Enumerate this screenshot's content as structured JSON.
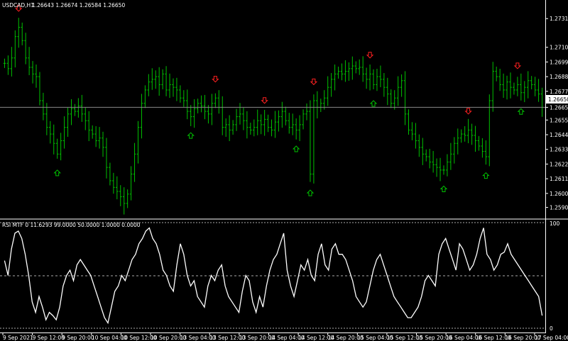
{
  "main_panel": {
    "symbol_label": "USDCAD,H1",
    "ohlc_label": "1.26643 1.26674 1.26584 1.26650",
    "current_price_label": "1.26650",
    "y_ticks": [
      "1.27315",
      "1.27100",
      "1.26990",
      "1.26880",
      "1.26770",
      "1.26650",
      "1.26555",
      "1.26445",
      "1.26335",
      "1.26225",
      "1.26115",
      "1.26005",
      "1.25900"
    ]
  },
  "rsi_panel": {
    "label": "RSI MTF 0 11.6293 99.0000 50.0000 1.0000 0.0000",
    "y_ticks": [
      "100",
      "0"
    ]
  },
  "x_ticks": [
    "9 Sep 2021",
    "9 Sep 12:00",
    "9 Sep 20:00",
    "10 Sep 04:00",
    "10 Sep 12:00",
    "10 Sep 20:00",
    "13 Sep 04:00",
    "13 Sep 12:00",
    "13 Sep 20:00",
    "14 Sep 04:00",
    "14 Sep 12:00",
    "14 Sep 20:00",
    "15 Sep 04:00",
    "15 Sep 12:00",
    "15 Sep 20:00",
    "16 Sep 04:00",
    "16 Sep 12:00",
    "16 Sep 20:00",
    "17 Sep 04:00"
  ],
  "chart_data": [
    {
      "type": "bar",
      "title": "USDCAD,H1",
      "series_style": "ohlc bars (green)",
      "ylim": [
        1.2585,
        1.2738
      ],
      "current_price": 1.2665,
      "close": [
        1.2698,
        1.2694,
        1.2702,
        1.2718,
        1.2725,
        1.2715,
        1.2702,
        1.2695,
        1.269,
        1.2688,
        1.267,
        1.266,
        1.265,
        1.2645,
        1.2638,
        1.263,
        1.264,
        1.265,
        1.266,
        1.2664,
        1.2662,
        1.2666,
        1.266,
        1.2655,
        1.2648,
        1.2645,
        1.264,
        1.2642,
        1.2635,
        1.262,
        1.261,
        1.2605,
        1.2602,
        1.2598,
        1.2593,
        1.26,
        1.2615,
        1.263,
        1.265,
        1.2668,
        1.2678,
        1.2684,
        1.2686,
        1.2688,
        1.2682,
        1.269,
        1.2678,
        1.2682,
        1.268,
        1.2678,
        1.2672,
        1.267,
        1.2662,
        1.2658,
        1.2664,
        1.2668,
        1.2666,
        1.2662,
        1.266,
        1.2668,
        1.2672,
        1.2665,
        1.265,
        1.2652,
        1.2648,
        1.2652,
        1.2658,
        1.266,
        1.2655,
        1.265,
        1.2648,
        1.265,
        1.2655,
        1.2652,
        1.2656,
        1.265,
        1.2648,
        1.2654,
        1.2658,
        1.2662,
        1.2655,
        1.265,
        1.2652,
        1.2648,
        1.2652,
        1.266,
        1.2662,
        1.2615,
        1.267,
        1.2665,
        1.2668,
        1.2672,
        1.268,
        1.2686,
        1.269,
        1.2692,
        1.269,
        1.2692,
        1.2694,
        1.2696,
        1.2694,
        1.2695,
        1.269,
        1.2686,
        1.269,
        1.2682,
        1.2688,
        1.2686,
        1.268,
        1.2675,
        1.2668,
        1.2672,
        1.268,
        1.2685,
        1.266,
        1.2648,
        1.2645,
        1.264,
        1.2635,
        1.263,
        1.2628,
        1.2624,
        1.2622,
        1.262,
        1.2618,
        1.2618,
        1.2624,
        1.263,
        1.2638,
        1.2642,
        1.2645,
        1.2644,
        1.2648,
        1.2644,
        1.264,
        1.2636,
        1.2632,
        1.2628,
        1.267,
        1.2692,
        1.2688,
        1.2682,
        1.2678,
        1.2684,
        1.268,
        1.2678,
        1.2682,
        1.2676,
        1.268,
        1.2685,
        1.2682,
        1.2678,
        1.2675,
        1.2665
      ]
    },
    {
      "type": "line",
      "title": "RSI MTF 0 11.6293 99.0000 50.0000 1.0000 0.0000",
      "ylim": [
        0,
        100
      ],
      "levels": [
        50
      ],
      "y": [
        64,
        50,
        75,
        90,
        92,
        85,
        70,
        50,
        25,
        15,
        30,
        20,
        8,
        15,
        12,
        8,
        20,
        40,
        50,
        55,
        45,
        60,
        65,
        60,
        55,
        50,
        40,
        30,
        20,
        10,
        5,
        20,
        35,
        40,
        50,
        45,
        55,
        65,
        70,
        80,
        85,
        92,
        95,
        85,
        80,
        70,
        55,
        50,
        40,
        35,
        60,
        80,
        70,
        50,
        40,
        45,
        30,
        25,
        20,
        40,
        50,
        45,
        55,
        60,
        40,
        30,
        25,
        20,
        15,
        35,
        50,
        45,
        25,
        15,
        30,
        20,
        40,
        55,
        65,
        70,
        80,
        90,
        55,
        40,
        30,
        45,
        60,
        55,
        65,
        50,
        45,
        70,
        80,
        60,
        55,
        75,
        80,
        70,
        70,
        65,
        55,
        45,
        30,
        25,
        20,
        25,
        40,
        55,
        65,
        70,
        60,
        50,
        40,
        30,
        25,
        20,
        15,
        10,
        10,
        15,
        20,
        30,
        45,
        50,
        45,
        40,
        70,
        80,
        85,
        75,
        65,
        55,
        80,
        75,
        65,
        55,
        60,
        70,
        85,
        95,
        70,
        65,
        55,
        60,
        70,
        72,
        80,
        70,
        65,
        60,
        55,
        50,
        45,
        40,
        35,
        30,
        12
      ]
    }
  ]
}
